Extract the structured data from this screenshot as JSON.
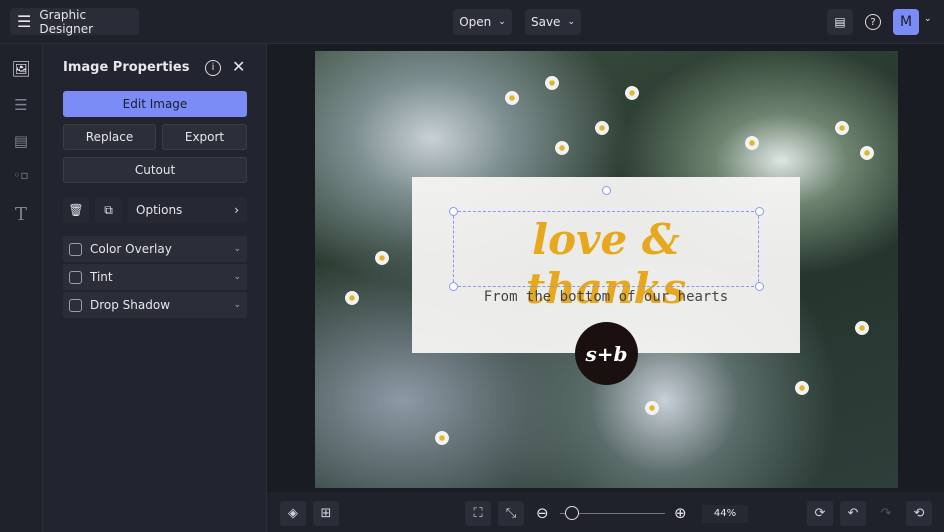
{
  "header": {
    "app_title": "Graphic Designer",
    "open_label": "Open",
    "save_label": "Save",
    "avatar_initial": "M"
  },
  "panel": {
    "title": "Image Properties",
    "edit_image": "Edit Image",
    "replace": "Replace",
    "export": "Export",
    "cutout": "Cutout",
    "options": "Options",
    "accordions": [
      {
        "label": "Color Overlay",
        "checked": false
      },
      {
        "label": "Tint",
        "checked": false
      },
      {
        "label": "Drop Shadow",
        "checked": false
      }
    ]
  },
  "canvas": {
    "headline": "love & thanks",
    "subtitle": "From the bottom of our hearts",
    "logo_text": "s+b"
  },
  "footer": {
    "zoom_level": "44%",
    "zoom_fraction": 0.05
  },
  "colors": {
    "accent": "#7b8cf7",
    "headline": "#e8a81e"
  }
}
